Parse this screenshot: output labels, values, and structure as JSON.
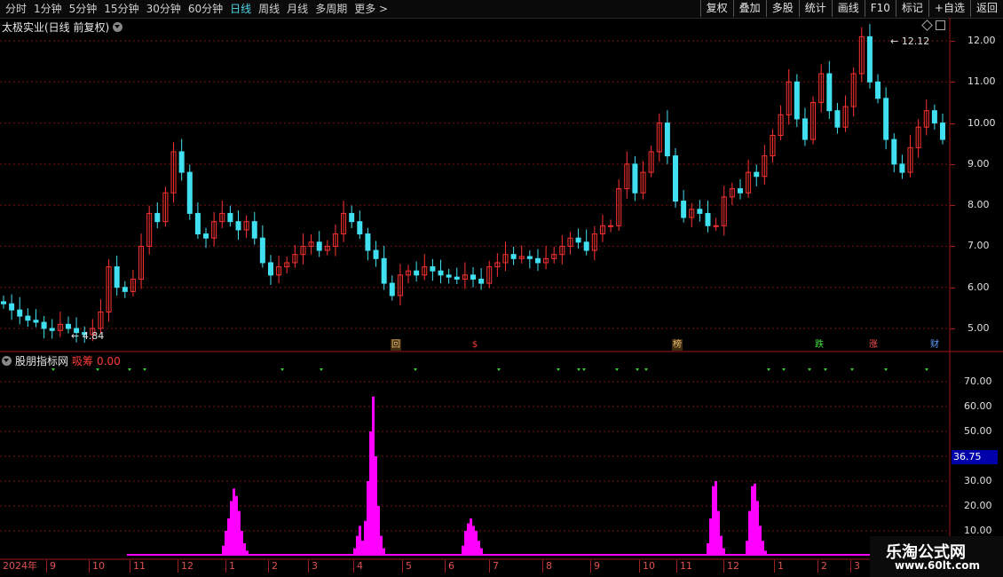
{
  "toolbar": {
    "periods": [
      "分时",
      "1分钟",
      "5分钟",
      "15分钟",
      "30分钟",
      "60分钟",
      "日线",
      "周线",
      "月线",
      "多周期",
      "更多 >"
    ],
    "active_period": "日线",
    "buttons": [
      "复权",
      "叠加",
      "多股",
      "统计",
      "画线",
      "F10",
      "标记",
      "+自选",
      "返回"
    ]
  },
  "stock": {
    "title": "太极实业(日线 前复权)",
    "high_label": "12.12",
    "low_label": "4.84"
  },
  "price_axis": [
    "12.00",
    "11.00",
    "10.00",
    "9.00",
    "8.00",
    "7.00",
    "6.00",
    "5.00"
  ],
  "event_markers": [
    {
      "label": "回",
      "color": "#e8c070"
    },
    {
      "label": "$",
      "color": "#ff3b3b"
    },
    {
      "label": "榜",
      "color": "#e8c070"
    },
    {
      "label": "跌",
      "color": "#40e040"
    },
    {
      "label": "涨",
      "color": "#ff5050"
    },
    {
      "label": "财",
      "color": "#60a0ff"
    }
  ],
  "indicator": {
    "name": "股朋指标网",
    "series_label": "吸筹",
    "series_value": "0.00",
    "axis": [
      "70.00",
      "60.00",
      "50.00",
      "40.00",
      "30.00",
      "20.00",
      "10.00"
    ],
    "current_value": "36.75"
  },
  "dates": {
    "year": "2024年",
    "months": [
      "9",
      "10",
      "11",
      "12",
      "1",
      "2",
      "3",
      "4",
      "5",
      "6",
      "7",
      "8",
      "9",
      "10",
      "11",
      "12",
      "1",
      "2",
      "3"
    ]
  },
  "watermark": {
    "name": "乐淘公式网",
    "url": "www.60lt.com"
  },
  "colors": {
    "up": "#ff3232",
    "down": "#40e0f0",
    "bar": "#ff00ff",
    "grid": "#7a1010"
  },
  "chart_data": {
    "type": "candlestick",
    "price_range": [
      4.8,
      12.12
    ],
    "close_series": [
      5.6,
      5.45,
      5.3,
      5.2,
      5.15,
      5.0,
      4.95,
      5.1,
      5.0,
      4.9,
      4.85,
      5.0,
      5.4,
      6.5,
      6.0,
      5.9,
      6.2,
      7.0,
      7.8,
      7.6,
      8.3,
      9.3,
      8.8,
      7.8,
      7.3,
      7.2,
      7.6,
      7.8,
      7.6,
      7.4,
      7.6,
      7.2,
      6.6,
      6.3,
      6.5,
      6.6,
      6.8,
      7.0,
      7.1,
      6.9,
      7.0,
      7.3,
      7.8,
      7.6,
      7.3,
      6.9,
      6.7,
      6.1,
      5.8,
      6.3,
      6.4,
      6.3,
      6.5,
      6.4,
      6.3,
      6.25,
      6.2,
      6.3,
      6.2,
      6.1,
      6.5,
      6.6,
      6.8,
      6.7,
      6.75,
      6.7,
      6.6,
      6.7,
      6.8,
      7.0,
      7.2,
      7.1,
      6.9,
      7.3,
      7.5,
      7.5,
      8.4,
      9.0,
      8.3,
      8.8,
      9.3,
      10.0,
      9.2,
      8.1,
      7.7,
      7.9,
      7.8,
      7.5,
      7.5,
      8.2,
      8.4,
      8.3,
      8.8,
      8.7,
      9.2,
      9.7,
      10.2,
      11.0,
      10.1,
      9.6,
      10.5,
      11.2,
      10.3,
      9.9,
      10.4,
      11.2,
      12.1,
      11.0,
      10.6,
      9.6,
      9.0,
      8.8,
      9.4,
      9.9,
      10.3,
      10.0,
      9.6
    ]
  }
}
